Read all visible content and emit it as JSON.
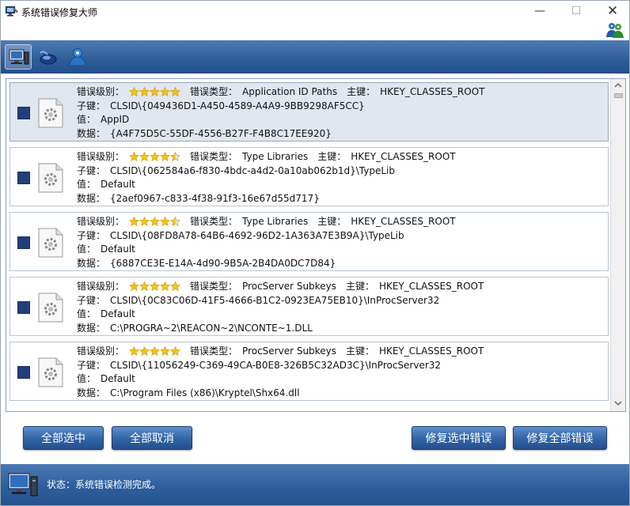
{
  "window": {
    "title": "系统错误修复大师",
    "minimize_glyph": "—",
    "maximize_glyph": "☐",
    "close_glyph": "✕"
  },
  "labels": {
    "level": "错误级别：",
    "type": "错误类型：",
    "root": "主键：",
    "subkey": "子键：",
    "value": "值：",
    "data": "数据："
  },
  "entries": [
    {
      "rating": 5,
      "type": "Application ID Paths",
      "root": "HKEY_CLASSES_ROOT",
      "subkey": "CLSID\\{049436D1-A450-4589-A4A9-9BB9298AF5CC}",
      "value": "AppID",
      "data": "{A4F75D5C-55DF-4556-B27F-F4B8C17EE920}",
      "selected": true
    },
    {
      "rating": 4.5,
      "type": "Type Libraries",
      "root": "HKEY_CLASSES_ROOT",
      "subkey": "CLSID\\{062584a6-f830-4bdc-a4d2-0a10ab062b1d}\\TypeLib",
      "value": "Default",
      "data": "{2aef0967-c833-4f38-91f3-16e67d55d717}",
      "selected": false
    },
    {
      "rating": 4.5,
      "type": "Type Libraries",
      "root": "HKEY_CLASSES_ROOT",
      "subkey": "CLSID\\{08FD8A78-64B6-4692-96D2-1A363A7E3B9A}\\TypeLib",
      "value": "Default",
      "data": "{6887CE3E-E14A-4d90-9B5A-2B4DA0DC7D84}",
      "selected": false
    },
    {
      "rating": 5,
      "type": "ProcServer Subkeys",
      "root": "HKEY_CLASSES_ROOT",
      "subkey": "CLSID\\{0C83C06D-41F5-4666-B1C2-0923EA75EB10}\\InProcServer32",
      "value": "Default",
      "data": "C:\\PROGRA~2\\REACON~2\\NCONTE~1.DLL",
      "selected": false
    },
    {
      "rating": 5,
      "type": "ProcServer Subkeys",
      "root": "HKEY_CLASSES_ROOT",
      "subkey": "CLSID\\{11056249-C369-49CA-B0E8-326B5C32AD3C}\\InProcServer32",
      "value": "Default",
      "data": "C:\\Program Files (x86)\\Kryptel\\Shx64.dll",
      "selected": false
    }
  ],
  "buttons": {
    "select_all": "全部选中",
    "deselect_all": "全部取消",
    "fix_selected": "修复选中错误",
    "fix_all": "修复全部错误"
  },
  "status": {
    "text": "状态：系统错误检测完成。"
  },
  "colors": {
    "toolbar": "#2d5c98",
    "button": "#3466a8",
    "star": "#f2c318",
    "checkbox": "#223f7a"
  },
  "icons": {
    "app": "computer-wrench-icon",
    "users": "users-icon",
    "toolbar": [
      "computer-icon",
      "mouse-icon",
      "user-icon"
    ],
    "entry": "file-gear-icon",
    "status": "computer-icon"
  }
}
